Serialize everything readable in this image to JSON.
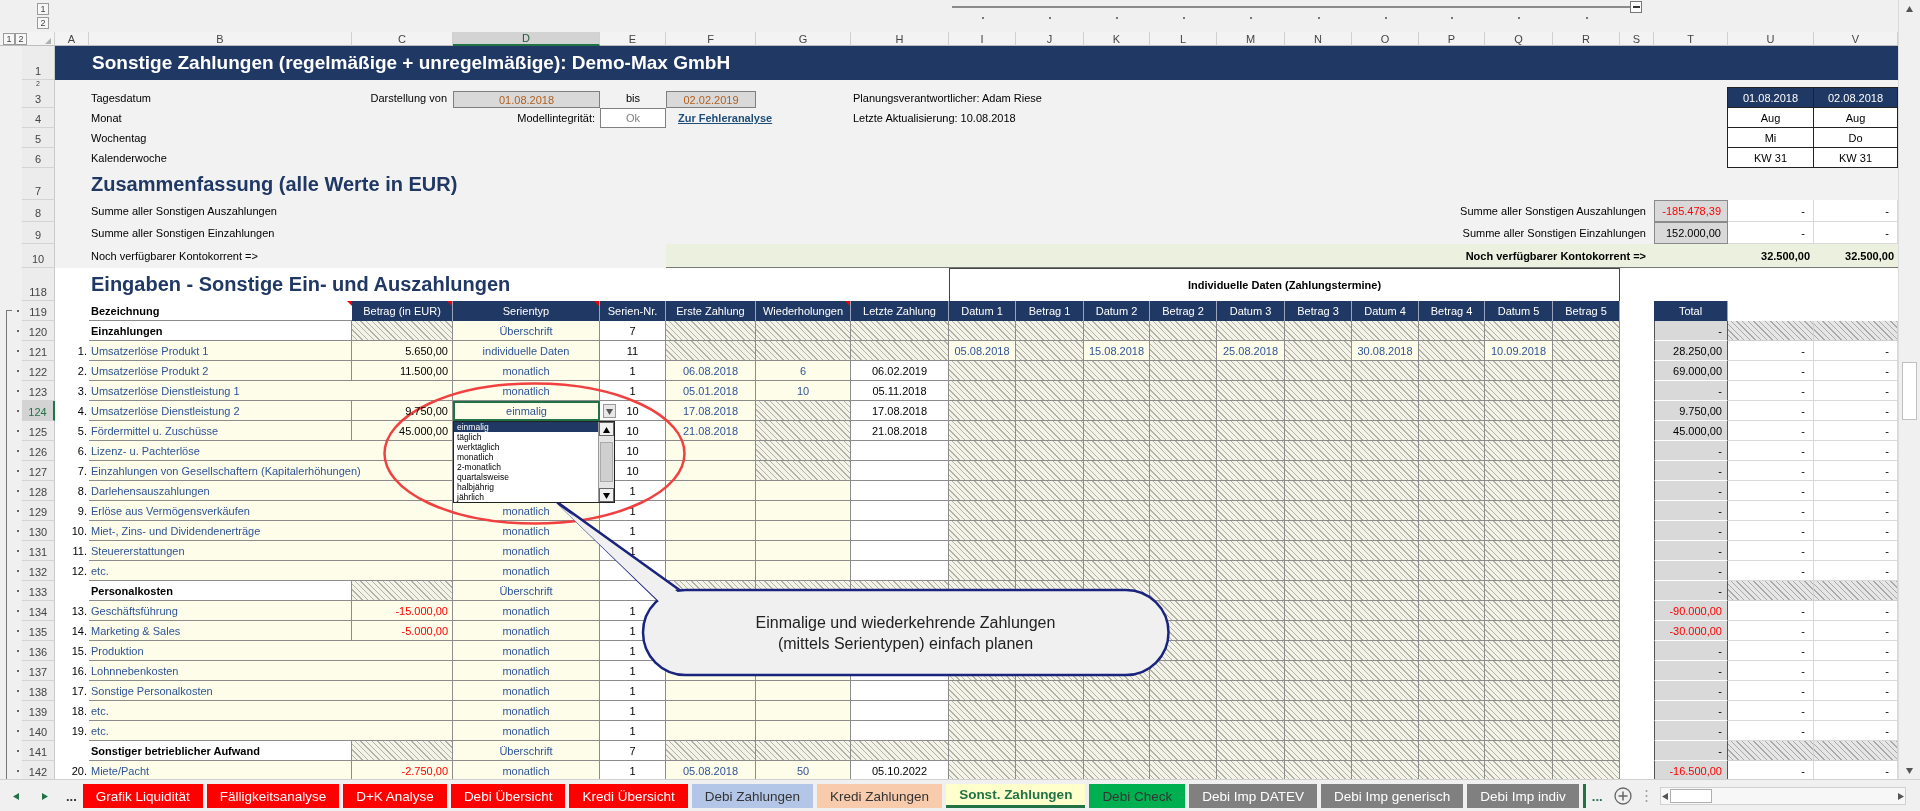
{
  "outline": {
    "column_levels": [
      "1",
      "2"
    ],
    "row_levels": [
      "1",
      "2"
    ]
  },
  "columns": [
    {
      "label": "A",
      "selected": false
    },
    {
      "label": "B",
      "selected": false
    },
    {
      "label": "C",
      "selected": false
    },
    {
      "label": "D",
      "selected": true
    },
    {
      "label": "E",
      "selected": false
    },
    {
      "label": "F",
      "selected": false
    },
    {
      "label": "G",
      "selected": false
    },
    {
      "label": "H",
      "selected": false
    },
    {
      "label": "I",
      "selected": false
    },
    {
      "label": "J",
      "selected": false
    },
    {
      "label": "K",
      "selected": false
    },
    {
      "label": "L",
      "selected": false
    },
    {
      "label": "M",
      "selected": false
    },
    {
      "label": "N",
      "selected": false
    },
    {
      "label": "O",
      "selected": false
    },
    {
      "label": "P",
      "selected": false
    },
    {
      "label": "Q",
      "selected": false
    },
    {
      "label": "R",
      "selected": false
    },
    {
      "label": "S",
      "selected": false
    },
    {
      "label": "T",
      "selected": false
    },
    {
      "label": "U",
      "selected": false
    },
    {
      "label": "V",
      "selected": false
    }
  ],
  "upper_row_numbers": [
    "1",
    "2",
    "3",
    "4",
    "5",
    "6",
    "7",
    "8",
    "9",
    "10"
  ],
  "title": "Sonstige Zahlungen (regelmäßige + unregelmäßige): Demo-Max GmbH",
  "info_labels": [
    "Tagesdatum",
    "Monat",
    "Wochentag",
    "Kalenderwoche"
  ],
  "range": {
    "label": "Darstellung von",
    "from": "01.08.2018",
    "to_label": "bis",
    "to": "02.02.2019"
  },
  "integrity": {
    "label": "Modellintegrität:",
    "value": "Ok",
    "link": "Zur Fehleranalyse"
  },
  "responsible": "Planungsverantwortlicher: Adam Riese",
  "last_update": "Letzte Aktualisierung: 10.08.2018",
  "calendar": [
    {
      "date": "01.08.2018",
      "month": "Aug",
      "weekday": "Mi",
      "week": "KW 31"
    },
    {
      "date": "02.08.2018",
      "month": "Aug",
      "weekday": "Do",
      "week": "KW 31"
    }
  ],
  "summary": {
    "title": "Zusammenfassung  (alle Werte in EUR)",
    "rows": [
      {
        "label": "Summe aller Sonstigen Auszahlungen",
        "right_label": "Summe aller Sonstigen Auszahlungen",
        "total": "-185.478,39",
        "negative": true,
        "values": [
          "-",
          "-"
        ]
      },
      {
        "label": "Summe aller Sonstigen Einzahlungen",
        "right_label": "Summe aller Sonstigen Einzahlungen",
        "total": "152.000,00",
        "negative": false,
        "values": [
          "-",
          "-"
        ]
      }
    ],
    "balance": {
      "label": "Noch verfügbarer Kontokorrent =>",
      "right_label": "Noch verfügbarer Kontokorrent =>",
      "values": [
        "32.500,00",
        "32.500,00"
      ]
    }
  },
  "input": {
    "title_row": "118",
    "header_row": "119",
    "title": "Eingaben - Sonstige Ein- und Auszahlungen",
    "individual_header": "Individuelle Daten (Zahlungstermine)",
    "columns": [
      {
        "label": "Bezeichnung",
        "comment": true
      },
      {
        "label": "Betrag (in EUR)",
        "comment": true
      },
      {
        "label": "Serientyp",
        "comment": true
      },
      {
        "label": "Serien-Nr.",
        "comment": false
      },
      {
        "label": "Erste Zahlung",
        "comment": false
      },
      {
        "label": "Wiederholungen",
        "comment": true
      },
      {
        "label": "Letzte Zahlung",
        "comment": false
      }
    ],
    "date_columns": [
      "Datum 1",
      "Betrag 1",
      "Datum 2",
      "Betrag 2",
      "Datum 3",
      "Betrag 3",
      "Datum 4",
      "Betrag 4",
      "Datum 5",
      "Betrag 5"
    ],
    "total_header": "Total",
    "rows": [
      {
        "row": "120",
        "selected": false,
        "kind": "section",
        "label": "Einzahlungen",
        "type": "Überschrift",
        "series": "7",
        "total": "-"
      },
      {
        "row": "121",
        "selected": false,
        "kind": "item",
        "number": "1.",
        "label": "Umsatzerlöse Produkt 1",
        "amount": "5.650,00",
        "negative": false,
        "type": "individuelle Daten",
        "series": "11",
        "first_locked": true,
        "repeats_locked": true,
        "last_locked": true,
        "dates": [
          "05.08.2018",
          "15.08.2018",
          "25.08.2018",
          "30.08.2018",
          "10.09.2018"
        ],
        "total": "28.250,00",
        "total_negative": false,
        "values": [
          "-",
          "-"
        ]
      },
      {
        "row": "122",
        "selected": false,
        "kind": "item",
        "number": "2.",
        "label": "Umsatzerlöse Produkt 2",
        "amount": "11.500,00",
        "negative": false,
        "type": "monatlich",
        "series": "1",
        "first": "06.08.2018",
        "repeats": "6",
        "last": "06.02.2019",
        "total": "69.000,00",
        "total_negative": false,
        "values": [
          "-",
          "-"
        ]
      },
      {
        "row": "123",
        "selected": false,
        "kind": "item",
        "number": "3.",
        "label": "Umsatzerlöse Dienstleistung 1",
        "type": "monatlich",
        "series": "1",
        "first": "05.01.2018",
        "repeats": "10",
        "last": "05.11.2018",
        "total": "-",
        "total_negative": false,
        "values": [
          "-",
          "-"
        ]
      },
      {
        "row": "124",
        "selected": true,
        "kind": "item",
        "number": "4.",
        "label": "Umsatzerlöse Dienstleistung 2",
        "amount": "9.750,00",
        "negative": false,
        "type": "einmalig",
        "series": "10",
        "first": "17.08.2018",
        "repeats_locked": true,
        "last": "17.08.2018",
        "total": "9.750,00",
        "total_negative": false,
        "values": [
          "-",
          "-"
        ],
        "dropdown": {
          "options": [
            {
              "label": "einmalig",
              "selected": true
            },
            {
              "label": "täglich",
              "selected": false
            },
            {
              "label": "werktäglich",
              "selected": false
            },
            {
              "label": "monatlich",
              "selected": false
            },
            {
              "label": "2-monatlich",
              "selected": false
            },
            {
              "label": "quartalsweise",
              "selected": false
            },
            {
              "label": "halbjährig",
              "selected": false
            },
            {
              "label": "jährlich",
              "selected": false
            }
          ]
        }
      },
      {
        "row": "125",
        "selected": false,
        "kind": "item",
        "number": "5.",
        "label": "Fördermittel u. Zuschüsse",
        "amount": "45.000,00",
        "negative": false,
        "series": "10",
        "first": "21.08.2018",
        "repeats_locked": true,
        "last": "21.08.2018",
        "total": "45.000,00",
        "total_negative": false,
        "values": [
          "-",
          "-"
        ]
      },
      {
        "row": "126",
        "selected": false,
        "kind": "item",
        "number": "6.",
        "label": "Lizenz- u. Pachterlöse",
        "series": "10",
        "repeats_locked": true,
        "total": "-",
        "total_negative": false,
        "values": [
          "-",
          "-"
        ]
      },
      {
        "row": "127",
        "selected": false,
        "kind": "item",
        "number": "7.",
        "label": "Einzahlungen von Gesellschaftern (Kapitalerhöhungen)",
        "series": "10",
        "repeats_locked": true,
        "total": "-",
        "total_negative": false,
        "values": [
          "-",
          "-"
        ]
      },
      {
        "row": "128",
        "selected": false,
        "kind": "item",
        "number": "8.",
        "label": "Darlehensauszahlungen",
        "series": "1",
        "total": "-",
        "total_negative": false,
        "values": [
          "-",
          "-"
        ]
      },
      {
        "row": "129",
        "selected": false,
        "kind": "item",
        "number": "9.",
        "label": "Erlöse aus Vermögensverkäufen",
        "type": "monatlich",
        "series": "1",
        "total": "-",
        "total_negative": false,
        "values": [
          "-",
          "-"
        ]
      },
      {
        "row": "130",
        "selected": false,
        "kind": "item",
        "number": "10.",
        "label": "Miet-, Zins- und Dividendenerträge",
        "type": "monatlich",
        "series": "1",
        "total": "-",
        "total_negative": false,
        "values": [
          "-",
          "-"
        ]
      },
      {
        "row": "131",
        "selected": false,
        "kind": "item",
        "number": "11.",
        "label": "Steuererstattungen",
        "type": "monatlich",
        "series": "1",
        "total": "-",
        "total_negative": false,
        "values": [
          "-",
          "-"
        ]
      },
      {
        "row": "132",
        "selected": false,
        "kind": "item",
        "number": "12.",
        "label": "etc.",
        "type": "monatlich",
        "total": "-",
        "total_negative": false,
        "values": [
          "-",
          "-"
        ]
      },
      {
        "row": "133",
        "selected": false,
        "kind": "section",
        "label": "Personalkosten",
        "type": "Überschrift",
        "total": "-"
      },
      {
        "row": "134",
        "selected": false,
        "kind": "item",
        "number": "13.",
        "label": "Geschäftsführung",
        "amount": "-15.000,00",
        "negative": true,
        "type": "monatlich",
        "series": "1",
        "total": "-90.000,00",
        "total_negative": true,
        "values": [
          "-",
          "-"
        ]
      },
      {
        "row": "135",
        "selected": false,
        "kind": "item",
        "number": "14.",
        "label": "Marketing & Sales",
        "amount": "-5.000,00",
        "negative": true,
        "type": "monatlich",
        "series": "1",
        "total": "-30.000,00",
        "total_negative": true,
        "values": [
          "-",
          "-"
        ]
      },
      {
        "row": "136",
        "selected": false,
        "kind": "item",
        "number": "15.",
        "label": "Produktion",
        "type": "monatlich",
        "series": "1",
        "total": "-",
        "total_negative": false,
        "values": [
          "-",
          "-"
        ]
      },
      {
        "row": "137",
        "selected": false,
        "kind": "item",
        "number": "16.",
        "label": "Lohnnebenkosten",
        "type": "monatlich",
        "series": "1",
        "total": "-",
        "total_negative": false,
        "values": [
          "-",
          "-"
        ]
      },
      {
        "row": "138",
        "selected": false,
        "kind": "item",
        "number": "17.",
        "label": "Sonstige Personalkosten",
        "type": "monatlich",
        "series": "1",
        "total": "-",
        "total_negative": false,
        "values": [
          "-",
          "-"
        ]
      },
      {
        "row": "139",
        "selected": false,
        "kind": "item",
        "number": "18.",
        "label": "etc.",
        "type": "monatlich",
        "series": "1",
        "total": "-",
        "total_negative": false,
        "values": [
          "-",
          "-"
        ]
      },
      {
        "row": "140",
        "selected": false,
        "kind": "item",
        "number": "19.",
        "label": "etc.",
        "type": "monatlich",
        "series": "1",
        "total": "-",
        "total_negative": false,
        "values": [
          "-",
          "-"
        ]
      },
      {
        "row": "141",
        "selected": false,
        "kind": "section",
        "label": "Sonstiger betrieblicher Aufwand",
        "type": "Überschrift",
        "series": "7",
        "total": "-"
      },
      {
        "row": "142",
        "selected": false,
        "kind": "item",
        "number": "20.",
        "label": "Miete/Pacht",
        "amount": "-2.750,00",
        "negative": true,
        "type": "monatlich",
        "series": "1",
        "first": "05.08.2018",
        "repeats": "50",
        "last": "05.10.2022",
        "total": "-16.500,00",
        "total_negative": true,
        "values": [
          "-",
          "-"
        ]
      }
    ]
  },
  "callout": "Einmalige und wiederkehrende Zahlungen (mittels Serientypen) einfach planen",
  "tab_nav_more": "...",
  "tabs": [
    {
      "label": "Grafik Liquidität",
      "selected": false,
      "color": "#ff0000"
    },
    {
      "label": "Fälligkeitsanalyse",
      "selected": false,
      "color": "#ff0000"
    },
    {
      "label": "D+K Analyse",
      "selected": false,
      "color": "#ff0000"
    },
    {
      "label": "Debi Übersicht",
      "selected": false,
      "color": "#ff0000"
    },
    {
      "label": "Kredi Übersicht",
      "selected": false,
      "color": "#ff0000"
    },
    {
      "label": "Debi Zahlungen",
      "selected": false,
      "color": "#b4c6e7"
    },
    {
      "label": "Kredi Zahlungen",
      "selected": false,
      "color": "#f8cbad"
    },
    {
      "label": "Sonst. Zahlungen",
      "selected": true,
      "color": "#ffffcc"
    },
    {
      "label": "Debi Check",
      "selected": false,
      "color": "#00b050"
    },
    {
      "label": "Debi Imp DATEV",
      "selected": false,
      "color": "#808080"
    },
    {
      "label": "Debi Imp generisch",
      "selected": false,
      "color": "#808080"
    },
    {
      "label": "Debi Imp indiv",
      "selected": false,
      "color": "#808080"
    }
  ],
  "tabs_more": "..."
}
